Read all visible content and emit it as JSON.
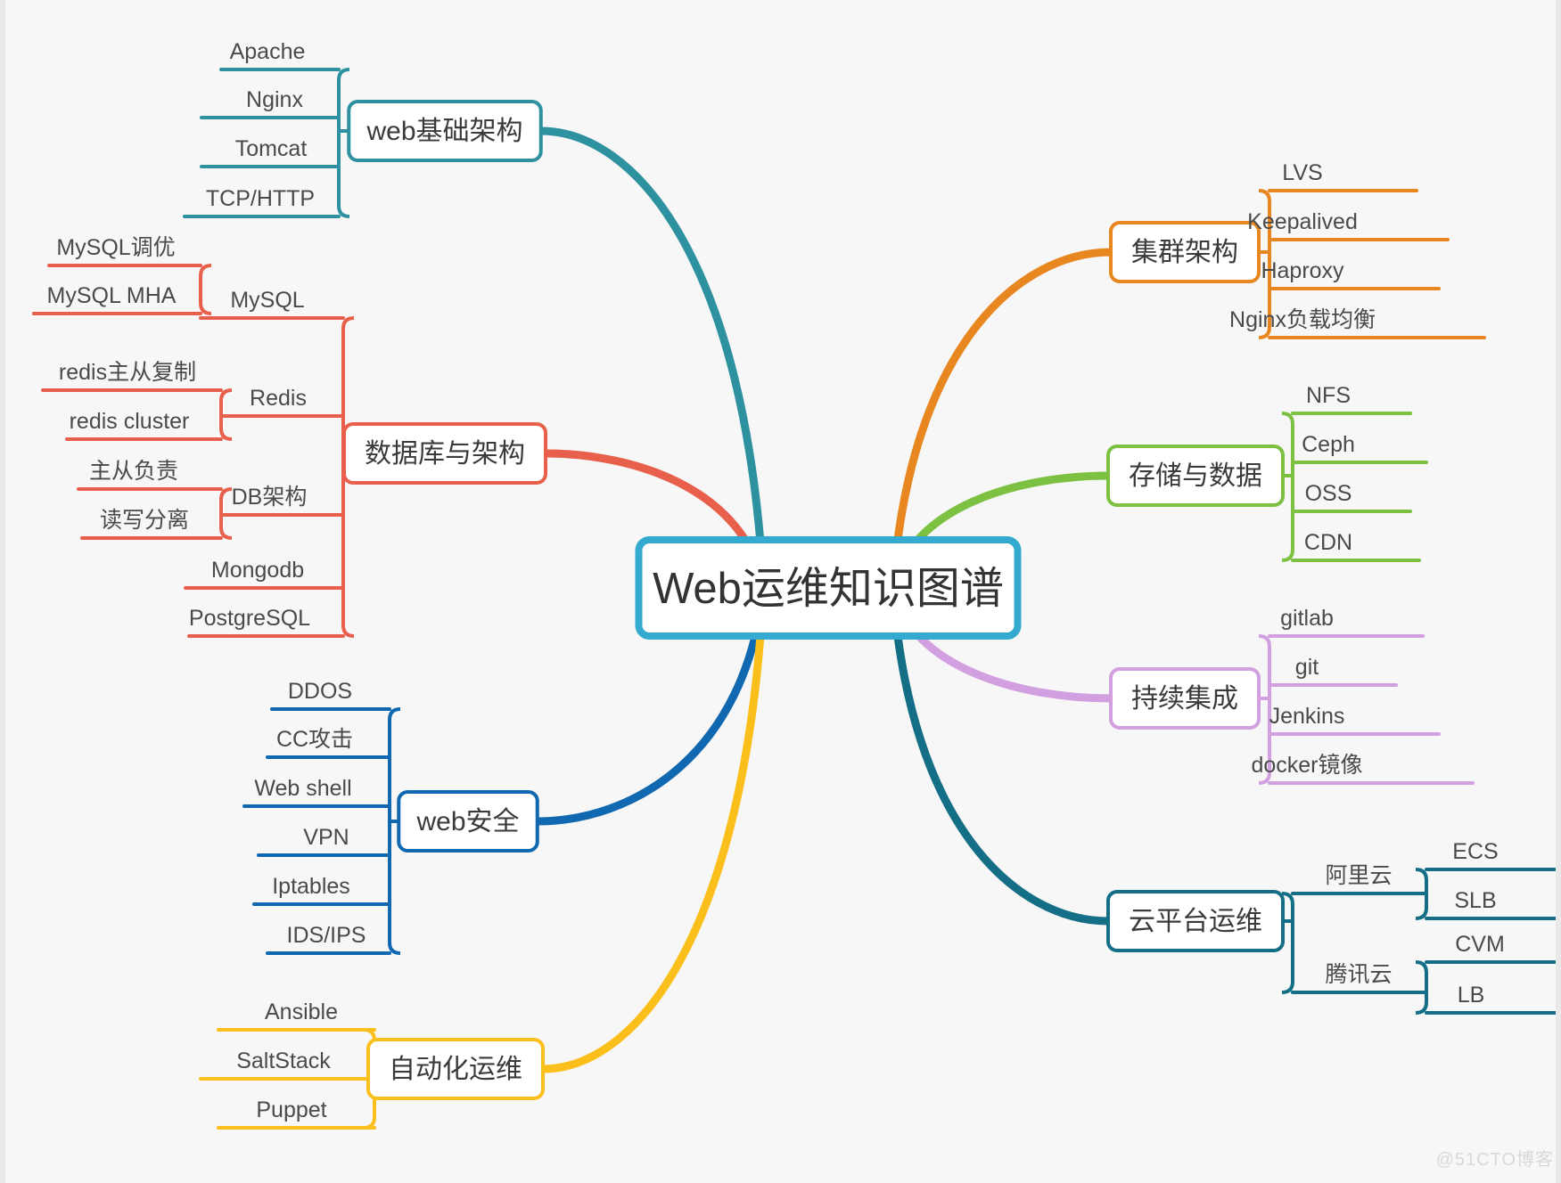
{
  "root": {
    "label": "Web运维知识图谱",
    "color": "#35AAD0"
  },
  "watermark": "@51CTO博客",
  "colors": {
    "web_base": "#2E91A0",
    "database": "#E8604C",
    "web_security": "#1068B0",
    "automation": "#FBBF1C",
    "cluster": "#E8861F",
    "storage": "#7CC142",
    "ci": "#D2A0E0",
    "cloud": "#136E86",
    "background": "#F7F7F7",
    "text": "#3A3A3A"
  },
  "branches": [
    {
      "id": "web-base",
      "label": "web基础架构",
      "color": "#2E91A0",
      "side": "left",
      "children": [
        {
          "label": "Apache"
        },
        {
          "label": "Nginx"
        },
        {
          "label": "Tomcat"
        },
        {
          "label": "TCP/HTTP"
        }
      ]
    },
    {
      "id": "database",
      "label": "数据库与架构",
      "color": "#E8604C",
      "side": "left",
      "children": [
        {
          "label": "MySQL",
          "children": [
            {
              "label": "MySQL调优"
            },
            {
              "label": "MySQL MHA"
            }
          ]
        },
        {
          "label": "Redis",
          "children": [
            {
              "label": "redis主从复制"
            },
            {
              "label": "redis cluster"
            }
          ]
        },
        {
          "label": "DB架构",
          "children": [
            {
              "label": "主从负责"
            },
            {
              "label": "读写分离"
            }
          ]
        },
        {
          "label": "Mongodb"
        },
        {
          "label": "PostgreSQL"
        }
      ]
    },
    {
      "id": "web-security",
      "label": "web安全",
      "color": "#1068B0",
      "side": "left",
      "children": [
        {
          "label": "DDOS"
        },
        {
          "label": "CC攻击"
        },
        {
          "label": "Web shell"
        },
        {
          "label": "VPN"
        },
        {
          "label": "Iptables"
        },
        {
          "label": "IDS/IPS"
        }
      ]
    },
    {
      "id": "automation",
      "label": "自动化运维",
      "color": "#FBBF1C",
      "side": "left",
      "children": [
        {
          "label": "Ansible"
        },
        {
          "label": "SaltStack"
        },
        {
          "label": "Puppet"
        }
      ]
    },
    {
      "id": "cluster",
      "label": "集群架构",
      "color": "#E8861F",
      "side": "right",
      "children": [
        {
          "label": "LVS"
        },
        {
          "label": "Keepalived"
        },
        {
          "label": "Haproxy"
        },
        {
          "label": "Nginx负载均衡"
        }
      ]
    },
    {
      "id": "storage",
      "label": "存储与数据",
      "color": "#7CC142",
      "side": "right",
      "children": [
        {
          "label": "NFS"
        },
        {
          "label": "Ceph"
        },
        {
          "label": "OSS"
        },
        {
          "label": "CDN"
        }
      ]
    },
    {
      "id": "ci",
      "label": "持续集成",
      "color": "#D2A0E0",
      "side": "right",
      "children": [
        {
          "label": "gitlab"
        },
        {
          "label": "git"
        },
        {
          "label": "Jenkins"
        },
        {
          "label": "docker镜像"
        }
      ]
    },
    {
      "id": "cloud",
      "label": "云平台运维",
      "color": "#136E86",
      "side": "right",
      "children": [
        {
          "label": "阿里云",
          "children": [
            {
              "label": "ECS"
            },
            {
              "label": "SLB"
            }
          ]
        },
        {
          "label": "腾讯云",
          "children": [
            {
              "label": "CVM"
            },
            {
              "label": "LB"
            }
          ]
        }
      ]
    }
  ]
}
